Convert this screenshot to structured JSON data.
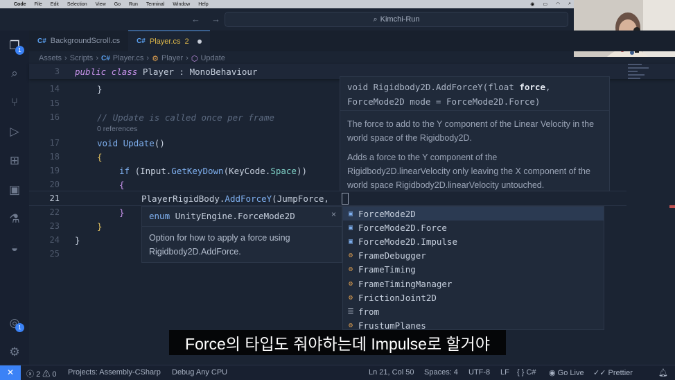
{
  "menubar": {
    "app": "Code",
    "items": [
      "File",
      "Edit",
      "Selection",
      "View",
      "Go",
      "Run",
      "Terminal",
      "Window",
      "Help"
    ]
  },
  "titlebar": {
    "back_icon": "arrow-left-icon",
    "forward_icon": "arrow-right-icon",
    "search_text": "Kimchi-Run"
  },
  "activity": {
    "explorer_badge": "1",
    "accounts_badge": "1"
  },
  "tabs": [
    {
      "label": "BackgroundScroll.cs",
      "icon": "C#"
    },
    {
      "label": "Player.cs",
      "problems": "2",
      "icon": "C#"
    }
  ],
  "breadcrumb": [
    "Assets",
    "Scripts",
    "Player.cs",
    "Player",
    "Update"
  ],
  "editor": {
    "sticky_line_number": "3",
    "sticky_line": {
      "kw1": "public",
      "kw2": "class",
      "name": "Player",
      "colon": ":",
      "base": "MonoBehaviour"
    },
    "line_numbers": [
      "14",
      "15",
      "16",
      "17",
      "18",
      "19",
      "20",
      "21",
      "22",
      "23",
      "24",
      "25"
    ],
    "comment": "// Update is called once per frame",
    "references": "0 references",
    "update_sig": {
      "kw": "void",
      "name": "Update",
      "parens": "()"
    },
    "if_line": {
      "kw": "if",
      "obj": "Input",
      "method": "GetKeyDown",
      "arg_type": "KeyCode",
      "arg_member": "Space"
    },
    "call_line": {
      "obj": "PlayerRigidBody",
      "method": "AddForceY",
      "args": "JumpForce,"
    }
  },
  "signature_help": {
    "line1_prefix": "void Rigidbody2D.AddForceY(float ",
    "line1_param": "force",
    "line1_suffix": ",",
    "line2": "ForceMode2D mode = ForceMode2D.Force)",
    "para1": "The force to add to the Y component of the Linear Velocity in the world space of the Rigidbody2D.",
    "para2": "Adds a force to the Y component of the Rigidbody2D.linearVelocity only leaving the X component of the world space Rigidbody2D.linearVelocity untouched."
  },
  "detail_popup": {
    "signature_kw": "enum",
    "signature_ns": "UnityEngine.",
    "signature_type": "ForceMode2D",
    "close": "×",
    "description": "Option for how to apply a force using Rigidbody2D.AddForce."
  },
  "suggestions": [
    {
      "label": "ForceMode2D",
      "kind": "enum"
    },
    {
      "label": "ForceMode2D.Force",
      "kind": "enum"
    },
    {
      "label": "ForceMode2D.Impulse",
      "kind": "enum"
    },
    {
      "label": "FrameDebugger",
      "kind": "class"
    },
    {
      "label": "FrameTiming",
      "kind": "class"
    },
    {
      "label": "FrameTimingManager",
      "kind": "class"
    },
    {
      "label": "FrictionJoint2D",
      "kind": "class"
    },
    {
      "label": "from",
      "kind": "keyword"
    },
    {
      "label": "FrustumPlanes",
      "kind": "class"
    }
  ],
  "subtitle": "Force의 타입도 줘야하는데 Impulse로 할거야",
  "statusbar": {
    "errors": "2",
    "warnings": "0",
    "project": "Projects: Assembly-CSharp",
    "config": "Debug Any CPU",
    "position": "Ln 21, Col 50",
    "spaces": "Spaces: 4",
    "encoding": "UTF-8",
    "eol": "LF",
    "language": "C#",
    "golive": "Go Live",
    "prettier": "Prettier"
  },
  "colors": {
    "background": "#1b2433",
    "accent": "#3b82f6",
    "keyword": "#c792ea",
    "function": "#7fb0f0",
    "modified_tab": "#e0b94a"
  }
}
